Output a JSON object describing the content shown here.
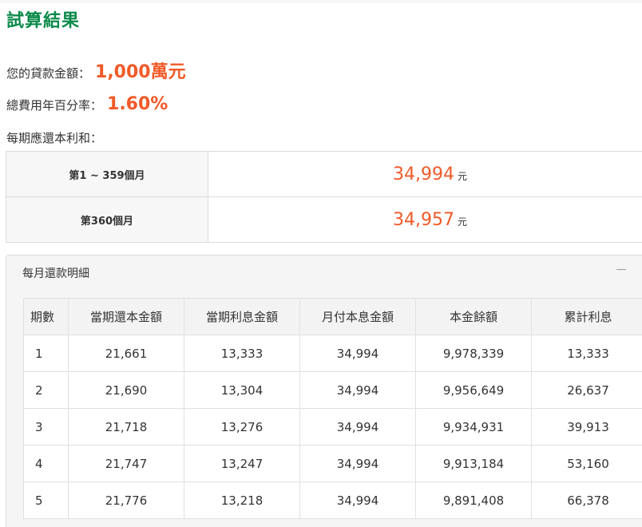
{
  "title": "試算結果",
  "summary": {
    "loan_label": "您的貸款金額：",
    "loan_value": "1,000萬元",
    "rate_label": "總費用年百分率：",
    "rate_value": "1.60%",
    "each_label": "每期應還本利和："
  },
  "periods": [
    {
      "label": "第1 ~ 359個月",
      "amount": "34,994",
      "unit": "元"
    },
    {
      "label": "第360個月",
      "amount": "34,957",
      "unit": "元"
    }
  ],
  "detail": {
    "header": "每月還款明細",
    "columns": [
      "期數",
      "當期還本金額",
      "當期利息金額",
      "月付本息金額",
      "本金餘額",
      "累計利息"
    ],
    "rows": [
      [
        "1",
        "21,661",
        "13,333",
        "34,994",
        "9,978,339",
        "13,333"
      ],
      [
        "2",
        "21,690",
        "13,304",
        "34,994",
        "9,956,649",
        "26,637"
      ],
      [
        "3",
        "21,718",
        "13,276",
        "34,994",
        "9,934,931",
        "39,913"
      ],
      [
        "4",
        "21,747",
        "13,247",
        "34,994",
        "9,913,184",
        "53,160"
      ],
      [
        "5",
        "21,776",
        "13,218",
        "34,994",
        "9,891,408",
        "66,378"
      ]
    ]
  },
  "colors": {
    "title_green": "#0a8a4a",
    "accent_orange": "#f05a28"
  },
  "icons": {
    "collapse": "collapse-icon"
  }
}
